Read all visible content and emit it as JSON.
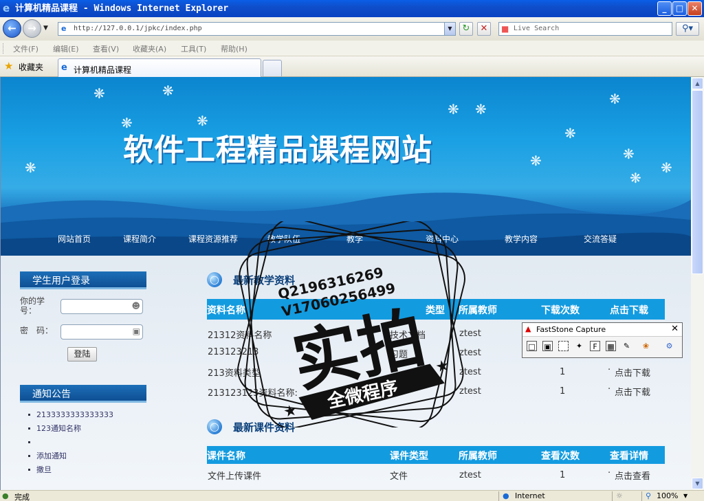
{
  "window": {
    "title": "计算机精品课程 - Windows Internet Explorer",
    "min_label": "_",
    "max_label": "□",
    "close_label": "✕"
  },
  "addr": {
    "url": "http://127.0.0.1/jpkc/index.php",
    "search_placeholder": "Live Search"
  },
  "menu": [
    "文件(F)",
    "编辑(E)",
    "查看(V)",
    "收藏夹(A)",
    "工具(T)",
    "帮助(H)"
  ],
  "favbar": {
    "favorites": "收藏夹",
    "tab_title": "计算机精品课程"
  },
  "site": {
    "title": "软件工程精品课程网站",
    "nav": [
      "网站首页",
      "课程简介",
      "课程资源推荐",
      "教学队伍",
      "教学",
      "资料中心",
      "教学内容",
      "交流答疑"
    ]
  },
  "login": {
    "header": "学生用户登录",
    "id_label": "你的学号：",
    "pwd_label": "密　码：",
    "submit": "登陆"
  },
  "notice": {
    "header": "通知公告",
    "items": [
      "2133333333333333",
      "123通知名称",
      "",
      "添加通知",
      "撒旦"
    ]
  },
  "materials": {
    "header": "最新教学资料",
    "columns": [
      "资料名称",
      "类型",
      "所属教师",
      "下载次数",
      "点击下载"
    ],
    "rows": [
      {
        "name": "21312资料名称",
        "type": "技术文档",
        "teacher": "ztest",
        "count": "",
        "action": ""
      },
      {
        "name": "213123213",
        "type": "习题",
        "teacher": "ztest",
        "count": "",
        "action": ""
      },
      {
        "name": "213资料类型",
        "type": "",
        "teacher": "ztest",
        "count": "1",
        "action": "点击下载"
      },
      {
        "name": "213123123资料名称:",
        "type": "ppt",
        "teacher": "ztest",
        "count": "1",
        "action": "点击下载"
      }
    ]
  },
  "courseware": {
    "header": "最新课件资料",
    "columns": [
      "课件名称",
      "课件类型",
      "所属教师",
      "查看次数",
      "查看详情"
    ],
    "rows": [
      {
        "name": "文件上传课件",
        "type": "文件",
        "teacher": "ztest",
        "count": "1",
        "action": "点击查看"
      }
    ]
  },
  "watermark": {
    "line1": "Q2196316269",
    "line2": "V17060256499",
    "big": "实拍",
    "ribbon": "全微程序"
  },
  "fastcapture": {
    "title": "FastStone Capture"
  },
  "status": {
    "left": "完成",
    "zone": "Internet",
    "zoom": "100%"
  },
  "colors": {
    "accent": "#139be0",
    "header_box": "#0e4f94",
    "banner": "#1aa0e4"
  }
}
